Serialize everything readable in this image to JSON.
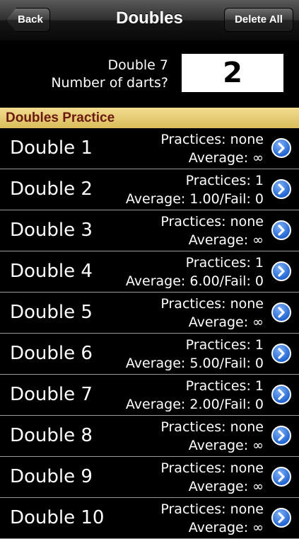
{
  "navbar": {
    "back_label": "Back",
    "title": "Doubles",
    "delete_label": "Delete All"
  },
  "prompt": {
    "line1": "Double 7",
    "line2": "Number of darts?",
    "value": "2"
  },
  "section": {
    "title": "Doubles Practice"
  },
  "rows": [
    {
      "title": "Double 1",
      "line1": "Practices: none",
      "line2": "Average: ∞"
    },
    {
      "title": "Double 2",
      "line1": "Practices: 1",
      "line2": "Average: 1.00/Fail: 0"
    },
    {
      "title": "Double 3",
      "line1": "Practices: none",
      "line2": "Average: ∞"
    },
    {
      "title": "Double 4",
      "line1": "Practices: 1",
      "line2": "Average: 6.00/Fail: 0"
    },
    {
      "title": "Double 5",
      "line1": "Practices: none",
      "line2": "Average: ∞"
    },
    {
      "title": "Double 6",
      "line1": "Practices: 1",
      "line2": "Average: 5.00/Fail: 0"
    },
    {
      "title": "Double 7",
      "line1": "Practices: 1",
      "line2": "Average: 2.00/Fail: 0"
    },
    {
      "title": "Double 8",
      "line1": "Practices: none",
      "line2": "Average: ∞"
    },
    {
      "title": "Double 9",
      "line1": "Practices: none",
      "line2": "Average: ∞"
    },
    {
      "title": "Double 10",
      "line1": "Practices: none",
      "line2": "Average: ∞"
    }
  ],
  "icons": {
    "row_accessory": "chevron-right-icon"
  },
  "colors": {
    "section_text": "#6b1a10",
    "section_bg": "#e6c96f",
    "accessory": "#2266d2"
  }
}
